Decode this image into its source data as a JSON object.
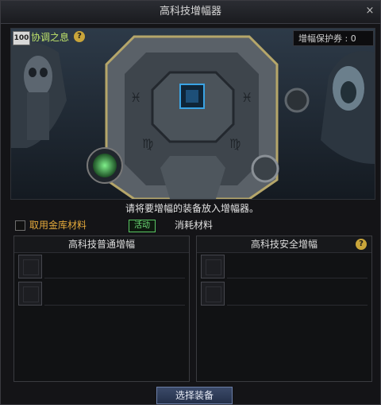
{
  "window": {
    "title": "高科技增幅器",
    "close_icon": "×"
  },
  "header": {
    "level_badge": "100",
    "title": "协调之息",
    "help_glyph": "?",
    "ticket_label": "增幅保护券 : 0"
  },
  "instruction": "请将要增幅的装备放入增幅器。",
  "options": {
    "checkbox_label": "取用金库材料",
    "tag_label": "活动",
    "consume_label": "消耗材料"
  },
  "left_panel": {
    "title": "高科技普通增幅"
  },
  "right_panel": {
    "title": "高科技安全增幅",
    "help_glyph": "?"
  },
  "select_button": "选择装备",
  "colors": {
    "accent_green": "#6fe07a",
    "gold_text": "#e4a93b",
    "help_gold": "#c9a53a",
    "button_blue": "#2e3c5c"
  }
}
